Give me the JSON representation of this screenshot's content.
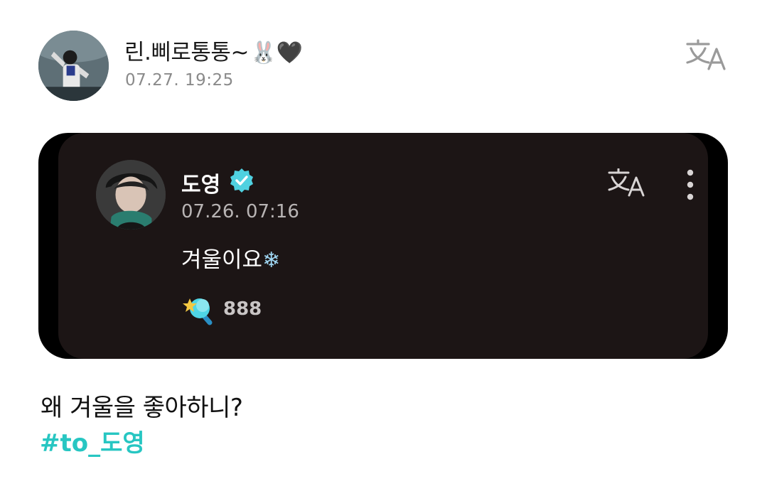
{
  "post": {
    "author": "린.삐로통통~",
    "author_emojis": "🐰🖤",
    "timestamp": "07.27. 19:25",
    "body_text": "왜 겨울을 좋아하니?",
    "hashtag": "#to_도영"
  },
  "quoted": {
    "author": "도영",
    "timestamp": "07.26. 07:16",
    "text": "겨울이요",
    "text_emoji": "❄",
    "like_count": "888"
  },
  "icons": {
    "translate": "translate-icon",
    "more": "more-vertical-icon",
    "verified": "verified-badge-icon",
    "lightstick": "lightstick-icon"
  },
  "colors": {
    "hashtag": "#27c6c2",
    "verified": "#4fd1e0",
    "card_background": "#1c1515"
  }
}
